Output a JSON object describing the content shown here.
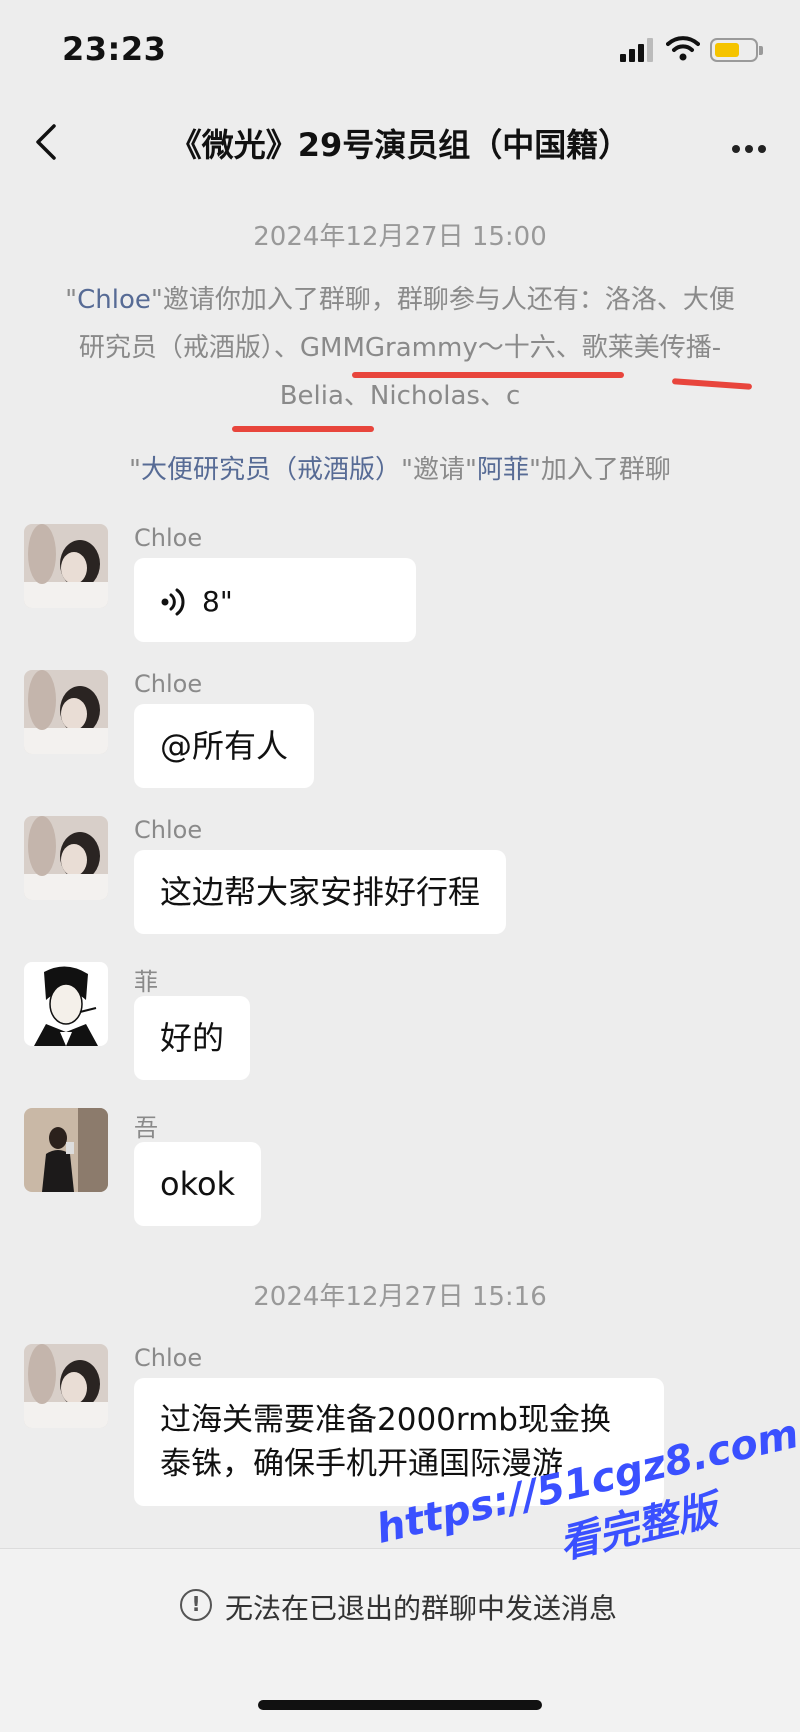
{
  "status": {
    "time": "23:23"
  },
  "header": {
    "title": "《微光》29号演员组（中国籍）",
    "back_icon": "chevron-left-icon",
    "more_icon": "more-dots-icon"
  },
  "timestamps": [
    "2024年12月27日 15:00",
    "2024年12月27日 15:16"
  ],
  "system_messages": {
    "invite": {
      "open_quote": "\"",
      "inviter": "Chloe",
      "text": "\"邀请你加入了群聊，群聊参与人还有：洛洛、大便研究员（戒酒版）、GMMGrammy～十六、歌莱美传播-Belia、Nicholas、c"
    },
    "join": {
      "q1": "\"",
      "inviter": "大便研究员（戒酒版）",
      "mid": "\"邀请\"",
      "invitee": "阿菲",
      "end": "\"加入了群聊"
    }
  },
  "messages": [
    {
      "sender": "Chloe",
      "content": "8\"",
      "type": "voice",
      "icon": "voice-icon"
    },
    {
      "sender": "Chloe",
      "content": "@所有人"
    },
    {
      "sender": "Chloe",
      "content": "这边帮大家安排好行程"
    },
    {
      "sender": "菲",
      "content": "好的"
    },
    {
      "sender": "吾",
      "content": "okok"
    },
    {
      "sender": "Chloe",
      "content": "过海关需要准备2000rmb现金换泰铢，确保手机开通国际漫游"
    }
  ],
  "footer": {
    "notice": "无法在已退出的群聊中发送消息",
    "icon": "alert-circle-icon"
  },
  "watermark": {
    "line1": "https://51cgz8.com",
    "line2": "看完整版"
  },
  "colors": {
    "background": "#ededed",
    "link": "#576b95",
    "highlight": "#e8453c",
    "battery": "#f5c400",
    "watermark": "#3a50ff"
  }
}
